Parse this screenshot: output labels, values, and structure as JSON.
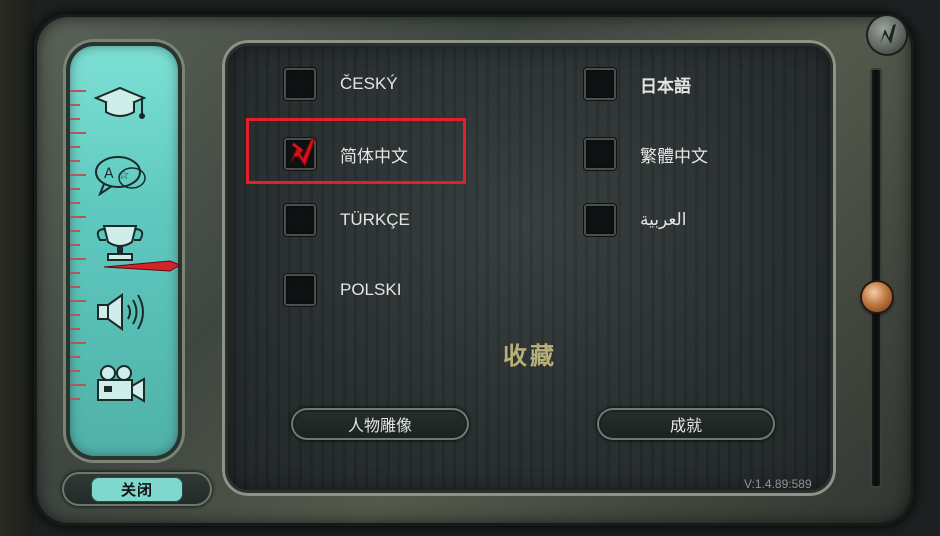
{
  "languages": [
    {
      "label": "ČESKÝ",
      "checked": false
    },
    {
      "label": "日本語",
      "checked": false
    },
    {
      "label": "简体中文",
      "checked": true
    },
    {
      "label": "繁體中文",
      "checked": false
    },
    {
      "label": "TÜRKÇE",
      "checked": false
    },
    {
      "label": "العربية",
      "checked": false
    },
    {
      "label": "POLSKI",
      "checked": false
    }
  ],
  "collection": {
    "title": "收藏",
    "portraits_button": "人物雕像",
    "achievements_button": "成就"
  },
  "close_button": "关闭",
  "version": "V:1.4.89:589",
  "nav_icons": [
    "graduation-cap-icon",
    "translate-speech-icon",
    "trophy-icon",
    "speaker-icon",
    "movie-camera-icon"
  ],
  "colors": {
    "selection_box": "#e0202a",
    "panel_teal": "#5fc9bf",
    "title_gold": "#b8b079",
    "check_red": "#d8101a"
  }
}
